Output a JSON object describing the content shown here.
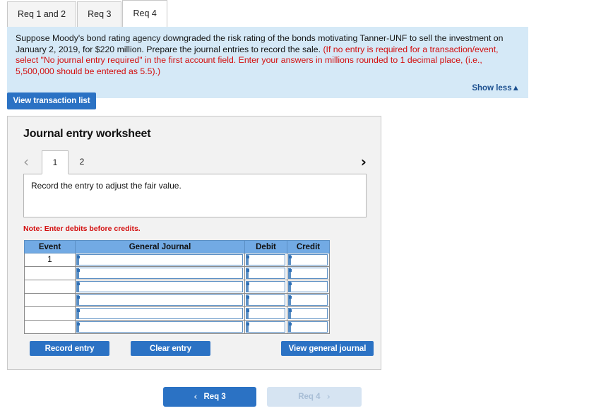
{
  "tabs": [
    {
      "label": "Req 1 and 2",
      "active": false
    },
    {
      "label": "Req 3",
      "active": false
    },
    {
      "label": "Req 4",
      "active": true
    }
  ],
  "instructions": {
    "black_text": "Suppose Moody's bond rating agency downgraded the risk rating of the bonds motivating Tanner-UNF to sell the investment on January 2, 2019, for $220 million. Prepare the journal entries to record the sale. ",
    "red_text": "(If no entry is required for a transaction/event, select \"No journal entry required\" in the first account field. Enter your answers in millions rounded to 1 decimal place, (i.e., 5,500,000 should be entered as 5.5).)",
    "show_less_label": "Show less",
    "show_less_caret": "▲"
  },
  "toolbar": {
    "view_transaction_list_label": "View transaction list"
  },
  "worksheet": {
    "title": "Journal entry worksheet",
    "pager": {
      "prev_icon": "‹",
      "next_icon": "›",
      "pages": [
        {
          "label": "1",
          "active": true
        },
        {
          "label": "2",
          "active": false
        }
      ]
    },
    "description": "Record the entry to adjust the fair value.",
    "note": "Note: Enter debits before credits.",
    "table": {
      "columns": [
        "Event",
        "General Journal",
        "Debit",
        "Credit"
      ],
      "rows": [
        {
          "event": "1",
          "journal": "",
          "debit": "",
          "credit": ""
        },
        {
          "event": "",
          "journal": "",
          "debit": "",
          "credit": ""
        },
        {
          "event": "",
          "journal": "",
          "debit": "",
          "credit": ""
        },
        {
          "event": "",
          "journal": "",
          "debit": "",
          "credit": ""
        },
        {
          "event": "",
          "journal": "",
          "debit": "",
          "credit": ""
        },
        {
          "event": "",
          "journal": "",
          "debit": "",
          "credit": ""
        }
      ]
    },
    "actions": {
      "record_entry_label": "Record entry",
      "clear_entry_label": "Clear entry",
      "view_general_journal_label": "View general journal"
    }
  },
  "bottom_nav": {
    "prev_label": "Req 3",
    "prev_icon": "‹",
    "next_label": "Req 4",
    "next_icon": "›"
  },
  "colors": {
    "accent_blue": "#2b72c4",
    "panel_blue": "#d5e9f7",
    "table_header_blue": "#72aae4",
    "alert_red": "#d30d0d",
    "link_navy": "#1b4f8f",
    "disabled_blue": "#d6e4f2"
  }
}
